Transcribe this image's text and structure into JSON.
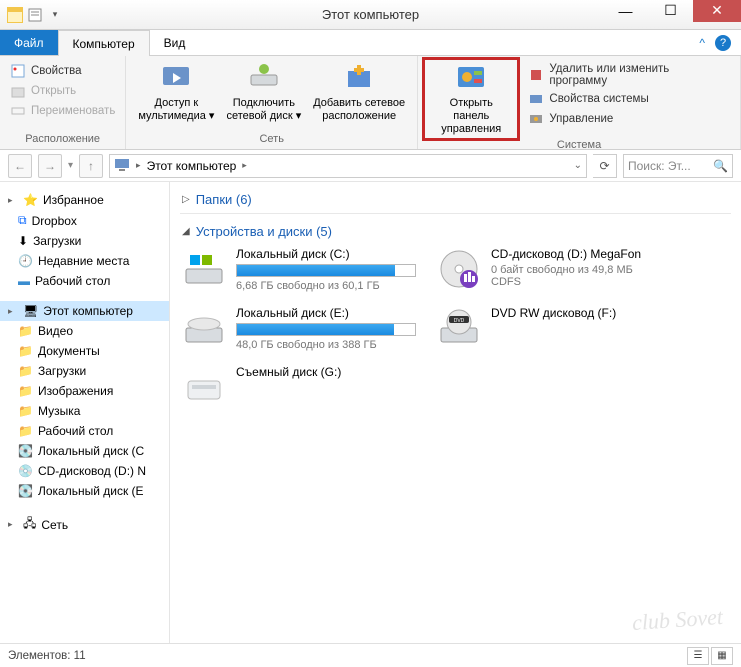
{
  "window": {
    "title": "Этот компьютер"
  },
  "tabs": {
    "file": "Файл",
    "computer": "Компьютер",
    "view": "Вид"
  },
  "ribbon": {
    "group_location": {
      "label": "Расположение",
      "props": "Свойства",
      "open": "Открыть",
      "rename": "Переименовать"
    },
    "group_network": {
      "label": "Сеть",
      "media1": "Доступ к",
      "media2": "мультимедиа",
      "netdrive1": "Подключить",
      "netdrive2": "сетевой диск",
      "addloc1": "Добавить сетевое",
      "addloc2": "расположение"
    },
    "group_system": {
      "label": "Система",
      "cpanel1": "Открыть панель",
      "cpanel2": "управления",
      "uninstall": "Удалить или изменить программу",
      "sysprops": "Свойства системы",
      "manage": "Управление"
    }
  },
  "address": {
    "root": "Этот компьютер"
  },
  "search": {
    "placeholder": "Поиск: Эт..."
  },
  "sidebar": {
    "favorites": "Избранное",
    "dropbox": "Dropbox",
    "downloads": "Загрузки",
    "recent": "Недавние места",
    "desktop": "Рабочий стол",
    "thispc": "Этот компьютер",
    "videos": "Видео",
    "documents": "Документы",
    "downloads2": "Загрузки",
    "pictures": "Изображения",
    "music": "Музыка",
    "desktop2": "Рабочий стол",
    "localc": "Локальный диск (C",
    "cddrive": "CD-дисковод (D:) N",
    "locale": "Локальный диск (E",
    "network": "Сеть"
  },
  "content": {
    "folders_heading": "Папки (6)",
    "devices_heading": "Устройства и диски (5)",
    "devs": {
      "c": {
        "name": "Локальный диск (C:)",
        "free": "6,68 ГБ свободно из 60,1 ГБ",
        "fill_pct": 89
      },
      "d": {
        "name": "CD-дисковод (D:) MegaFon",
        "free": "0 байт свободно из 49,8 МБ",
        "fs": "CDFS"
      },
      "e": {
        "name": "Локальный диск (E:)",
        "free": "48,0 ГБ свободно из 388 ГБ",
        "fill_pct": 88
      },
      "f": {
        "name": "DVD RW дисковод (F:)"
      },
      "g": {
        "name": "Съемный диск (G:)"
      }
    }
  },
  "status": {
    "count": "Элементов: 11"
  },
  "watermark": "club Sovet"
}
